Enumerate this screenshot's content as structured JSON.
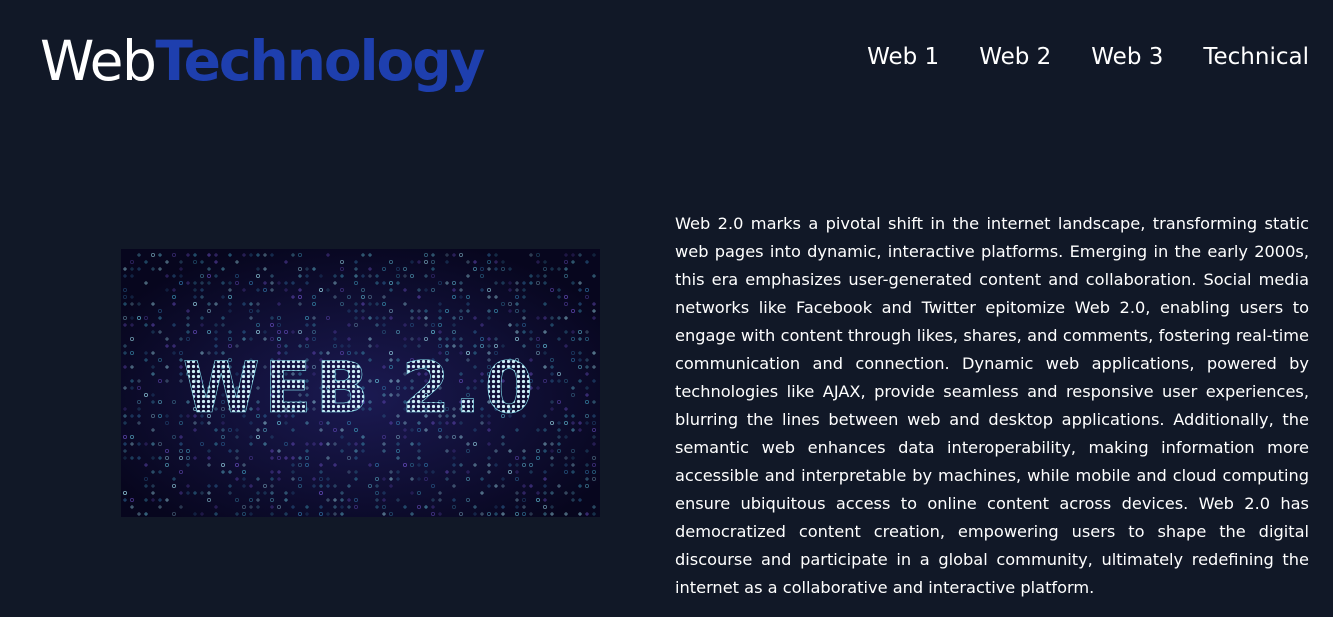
{
  "header": {
    "logo_part1": "Web",
    "logo_part2": "Technology",
    "nav": [
      "Web 1",
      "Web 2",
      "Web 3",
      "Technical"
    ]
  },
  "hero": {
    "image_text": "WEB 2.0",
    "image_icon": "web-2-0-banner-image"
  },
  "content": {
    "paragraph": "Web 2.0 marks a pivotal shift in the internet landscape, transforming static web pages into dynamic, interactive platforms. Emerging in the early 2000s, this era emphasizes user-generated content and collaboration. Social media networks like Facebook and Twitter epitomize Web 2.0, enabling users to engage with content through likes, shares, and comments, fostering real-time communication and connection. Dynamic web applications, powered by technologies like AJAX, provide seamless and responsive user experiences, blurring the lines between web and desktop applications. Additionally, the semantic web enhances data interoperability, making information more accessible and interpretable by machines, while mobile and cloud computing ensure ubiquitous access to online content across devices. Web 2.0 has democratized content creation, empowering users to shape the digital discourse and participate in a global community, ultimately redefining the internet as a collaborative and interactive platform."
  },
  "colors": {
    "background": "#111827",
    "logo_accent": "#1e3fae",
    "text": "#ffffff",
    "image_background": "#0b0a2a",
    "image_text": "#7fd6e6"
  }
}
